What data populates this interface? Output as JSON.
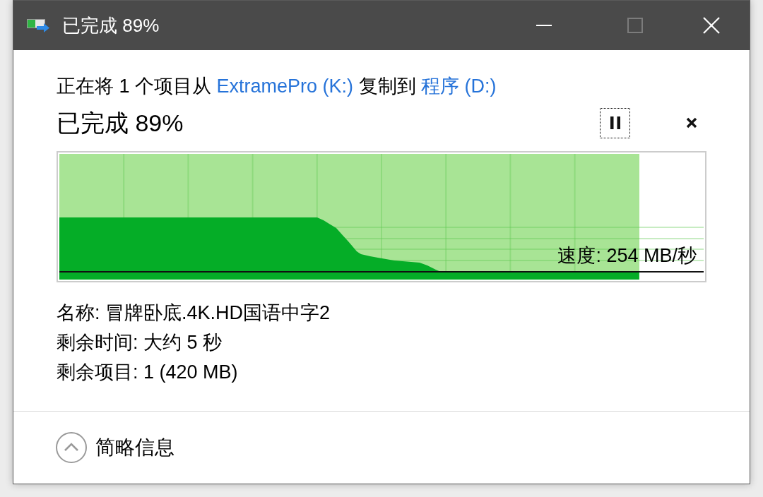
{
  "window": {
    "title": "已完成 89%",
    "controls": [
      {
        "kind": "minimize",
        "disabled": false
      },
      {
        "kind": "maximize",
        "disabled": true
      },
      {
        "kind": "close",
        "disabled": false
      }
    ]
  },
  "status": {
    "parts": [
      {
        "kind": "text",
        "text": "正在将 1 个项目从 "
      },
      {
        "kind": "link",
        "text": "ExtramePro (K:)"
      },
      {
        "kind": "text",
        "text": " 复制到 "
      },
      {
        "kind": "link",
        "text": "程序 (D:)"
      }
    ]
  },
  "progress": {
    "heading": "已完成 89%",
    "level": 0.9,
    "speed": "速度: 254 MB/秒"
  },
  "actions": [
    {
      "kind": "pause",
      "focused": true
    },
    {
      "kind": "cancel",
      "focused": false
    }
  ],
  "details": [
    "名称: 冒牌卧底.4K.HD国语中字2",
    "剩余时间: 大约 5 秒",
    "剩余项目: 1 (420 MB)"
  ],
  "footer": {
    "toggle": "简略信息",
    "expanded": true
  }
}
